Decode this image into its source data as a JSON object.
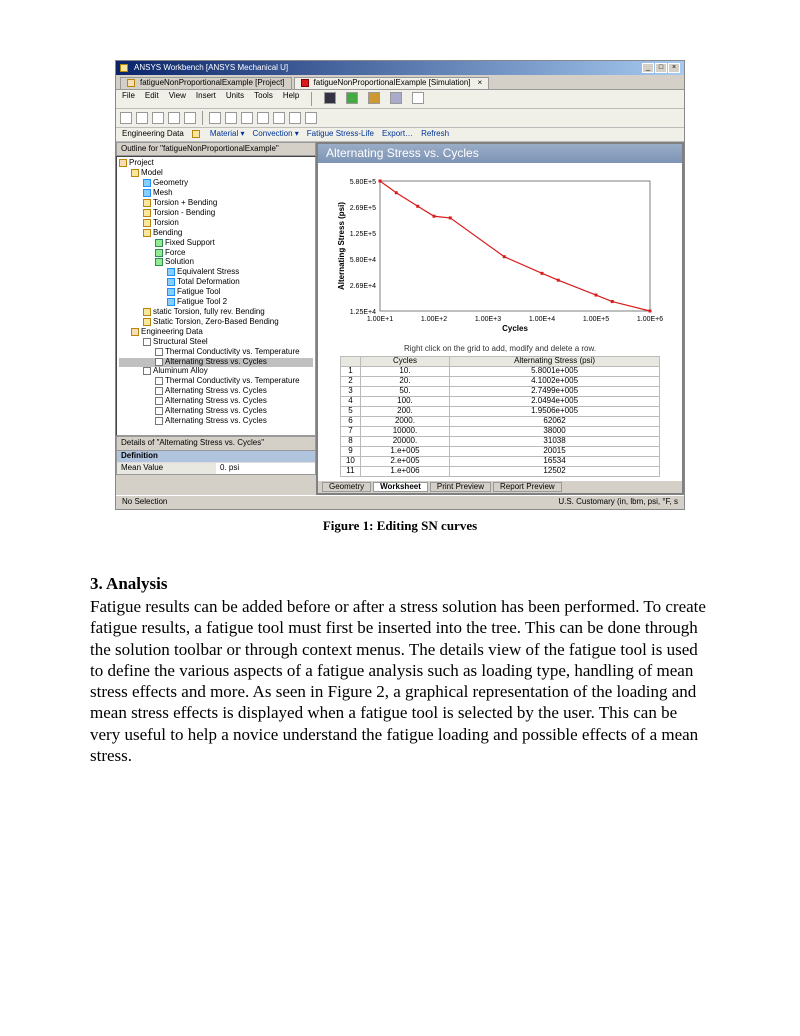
{
  "app": {
    "title": "ANSYS Workbench [ANSYS Mechanical U]",
    "tabs": [
      {
        "label": "fatigueNonProportionalExample [Project]",
        "active": false
      },
      {
        "label": "fatigueNonProportionalExample [Simulation]",
        "active": true
      }
    ],
    "menu": [
      "File",
      "Edit",
      "View",
      "Insert",
      "Units",
      "Tools",
      "Help"
    ],
    "context_toolbar": {
      "items": [
        "Engineering Data",
        "Material ▾",
        "Convection ▾",
        "Fatigue Stress-Life",
        "Export…",
        "Refresh"
      ]
    }
  },
  "outline": {
    "header": "Outline for \"fatigueNonProportionalExample\"",
    "tree": [
      {
        "lvl": 0,
        "icon": "ic-folder",
        "label": "Project"
      },
      {
        "lvl": 1,
        "icon": "ic-yellow",
        "label": "Model"
      },
      {
        "lvl": 2,
        "icon": "ic-blue",
        "label": "Geometry"
      },
      {
        "lvl": 2,
        "icon": "ic-blue",
        "label": "Mesh"
      },
      {
        "lvl": 2,
        "icon": "ic-yellow",
        "label": "Torsion + Bending"
      },
      {
        "lvl": 2,
        "icon": "ic-yellow",
        "label": "Torsion - Bending"
      },
      {
        "lvl": 2,
        "icon": "ic-yellow",
        "label": "Torsion"
      },
      {
        "lvl": 2,
        "icon": "ic-yellow",
        "label": "Bending"
      },
      {
        "lvl": 3,
        "icon": "ic-green",
        "label": "Fixed Support"
      },
      {
        "lvl": 3,
        "icon": "ic-green",
        "label": "Force"
      },
      {
        "lvl": 3,
        "icon": "ic-green",
        "label": "Solution"
      },
      {
        "lvl": 4,
        "icon": "ic-blue",
        "label": "Equivalent Stress"
      },
      {
        "lvl": 4,
        "icon": "ic-blue",
        "label": "Total Deformation"
      },
      {
        "lvl": 4,
        "icon": "ic-blue",
        "label": "Fatigue Tool"
      },
      {
        "lvl": 4,
        "icon": "ic-blue",
        "label": "Fatigue Tool 2"
      },
      {
        "lvl": 2,
        "icon": "ic-yellow",
        "label": "static Torsion, fully rev. Bending"
      },
      {
        "lvl": 2,
        "icon": "ic-yellow",
        "label": "Static Torsion, Zero-Based Bending"
      },
      {
        "lvl": 1,
        "icon": "ic-folder",
        "label": "Engineering Data"
      },
      {
        "lvl": 2,
        "icon": "ic-box",
        "label": "Structural Steel"
      },
      {
        "lvl": 3,
        "icon": "ic-box",
        "label": "Thermal Conductivity vs. Temperature"
      },
      {
        "lvl": 3,
        "icon": "ic-box",
        "label": "Alternating Stress vs. Cycles",
        "sel": true
      },
      {
        "lvl": 2,
        "icon": "ic-box",
        "label": "Aluminum Alloy"
      },
      {
        "lvl": 3,
        "icon": "ic-box",
        "label": "Thermal Conductivity vs. Temperature"
      },
      {
        "lvl": 3,
        "icon": "ic-box",
        "label": "Alternating Stress vs. Cycles"
      },
      {
        "lvl": 3,
        "icon": "ic-box",
        "label": "Alternating Stress vs. Cycles"
      },
      {
        "lvl": 3,
        "icon": "ic-box",
        "label": "Alternating Stress vs. Cycles"
      },
      {
        "lvl": 3,
        "icon": "ic-box",
        "label": "Alternating Stress vs. Cycles"
      }
    ]
  },
  "details": {
    "header": "Details of \"Alternating Stress vs. Cycles\"",
    "section": "Definition",
    "rows": [
      {
        "k": "Mean Value",
        "v": "0. psi"
      }
    ]
  },
  "chart": {
    "title": "Alternating Stress vs. Cycles",
    "hint": "Right click on the grid to add, modify and delete a row.",
    "xlabel": "Cycles",
    "ylabel": "Alternating Stress (psi)",
    "grid_headers": [
      "",
      "Cycles",
      "Alternating Stress (psi)"
    ]
  },
  "chart_data": {
    "type": "line",
    "title": "Alternating Stress vs. Cycles",
    "xlabel": "Cycles",
    "ylabel": "Alternating Stress (psi)",
    "xscale": "log",
    "yscale": "log",
    "xlim": [
      10.0,
      1000000.0
    ],
    "ylim": [
      12500.0,
      580000.0
    ],
    "xticks": [
      "1.00E+1",
      "1.00E+2",
      "1.00E+3",
      "1.00E+4",
      "1.00E+5",
      "1.00E+6"
    ],
    "yticks": [
      "1.25E+4",
      "2.69E+4",
      "5.80E+4",
      "1.25E+5",
      "2.69E+5",
      "5.80E+5"
    ],
    "series": [
      {
        "name": "Alternating Stress",
        "color": "#d81b1b",
        "x": [
          10,
          20,
          50,
          100,
          200,
          2000,
          10000,
          20000,
          100000.0,
          200000.0,
          1000000.0
        ],
        "values": [
          580010.0,
          410020.0,
          274990.0,
          204940.0,
          195060.0,
          62062,
          38000,
          31038,
          20015,
          16534,
          12502
        ]
      }
    ]
  },
  "bottom_tabs": [
    "Geometry",
    "Worksheet",
    "Print Preview",
    "Report Preview"
  ],
  "statusbar": {
    "left": "No Selection",
    "right": "U.S. Customary (in, lbm, psi, °F, s"
  },
  "figure_caption": "Figure 1: Editing SN curves",
  "doc": {
    "heading": "3.  Analysis",
    "body": "Fatigue results can be added before or after a stress solution has been performed.  To create fatigue results, a fatigue tool must first be inserted into the tree.  This can be done through the solution toolbar or through context menus.  The details view of the fatigue tool is used to define the various aspects of a fatigue analysis such as loading type, handling of mean stress effects and more.  As seen in Figure 2, a graphical representation of the loading and mean stress effects is displayed when a fatigue tool is selected by the user.  This can be very useful to help a novice understand the fatigue loading and possible effects of a mean stress."
  }
}
